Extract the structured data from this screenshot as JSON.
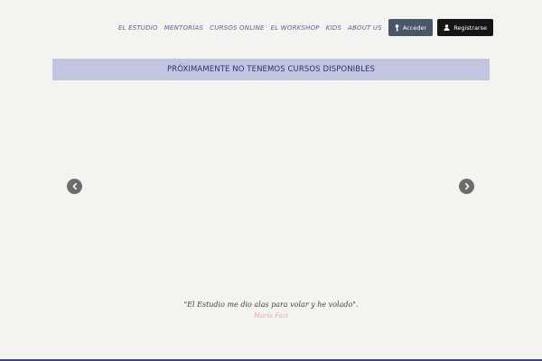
{
  "nav": {
    "links": [
      {
        "label": "EL ESTUDIO"
      },
      {
        "label": "MENTORÍAS"
      },
      {
        "label": "CURSOS ONLINE"
      },
      {
        "label": "EL WORKSHOP"
      },
      {
        "label": "KIDS"
      },
      {
        "label": "ABOUT US"
      }
    ],
    "login_label": "Acceder",
    "login_icon": "key-icon",
    "register_label": "Registrarse",
    "register_icon": "user-icon"
  },
  "notice": {
    "text": "PRÓXIMAMENTE NO TENEMOS CURSOS DISPONIBLES"
  },
  "slider": {
    "prev_icon": "chevron-left-icon",
    "next_icon": "chevron-right-icon"
  },
  "testimonial": {
    "quote": "\"El Estudio me dio alas para volar y he volado\".",
    "author": "María Faci"
  },
  "colors": {
    "background": "#f3f3ef",
    "notice_bg": "#c3c4e0",
    "nav_link": "#5a5f9e",
    "login_button": "#4a5766",
    "register_button": "#161616",
    "author_text": "#e2a8ad",
    "accent_bar": "#3d447e"
  }
}
